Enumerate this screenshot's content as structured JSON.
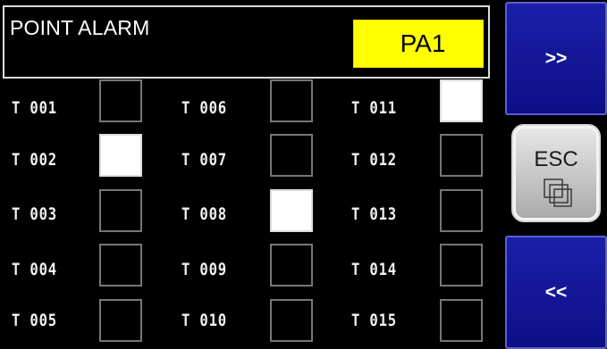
{
  "header": {
    "title": "POINT ALARM",
    "code": "PA1"
  },
  "points": [
    {
      "label": "T 001",
      "on": false
    },
    {
      "label": "T 002",
      "on": true
    },
    {
      "label": "T 003",
      "on": false
    },
    {
      "label": "T 004",
      "on": false
    },
    {
      "label": "T 005",
      "on": false
    },
    {
      "label": "T 006",
      "on": false
    },
    {
      "label": "T 007",
      "on": false
    },
    {
      "label": "T 008",
      "on": true
    },
    {
      "label": "T 009",
      "on": false
    },
    {
      "label": "T 010",
      "on": false
    },
    {
      "label": "T 011",
      "on": true
    },
    {
      "label": "T 012",
      "on": false
    },
    {
      "label": "T 013",
      "on": false
    },
    {
      "label": "T 014",
      "on": false
    },
    {
      "label": "T 015",
      "on": false
    }
  ],
  "nav": {
    "next_label": ">>",
    "esc_label": "ESC",
    "prev_label": "<<"
  },
  "colors": {
    "code_bg": "#ffff00",
    "nav_bg": "#0d0f86",
    "esc_bg": "#c4c4c4"
  }
}
